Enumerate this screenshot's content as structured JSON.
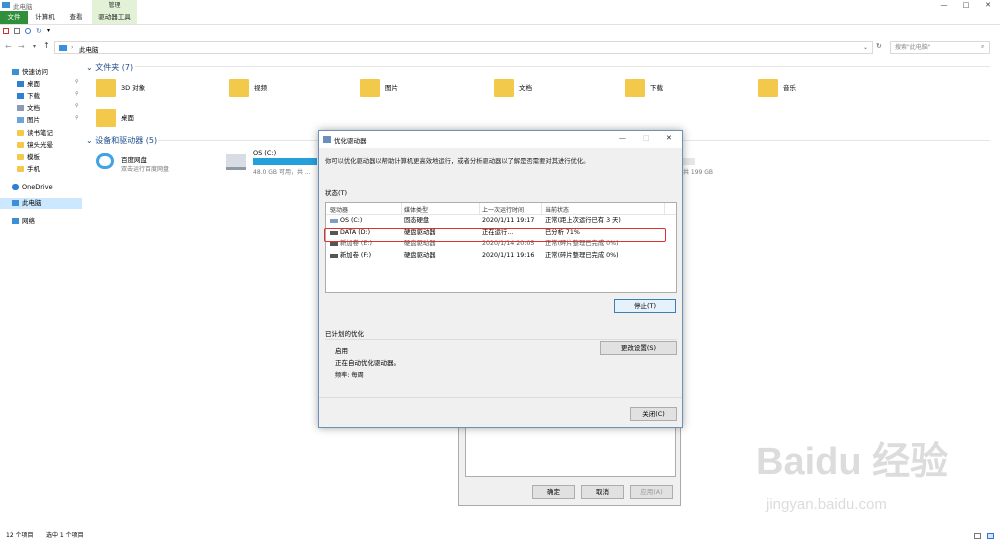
{
  "window": {
    "title": "此电脑",
    "minimize": "—",
    "maximize": "□",
    "close": "✕"
  },
  "ribbon": {
    "tabs": [
      "文件",
      "计算机",
      "查看",
      "驱动器工具"
    ],
    "context_header": "管理"
  },
  "address": {
    "path": "此电脑",
    "search_placeholder": "搜索\"此电脑\""
  },
  "nav": {
    "items": [
      {
        "label": "快速访问",
        "icon": "star-icon"
      },
      {
        "label": "桌面",
        "icon": "desktop-icon"
      },
      {
        "label": "下载",
        "icon": "download-icon"
      },
      {
        "label": "文档",
        "icon": "document-icon"
      },
      {
        "label": "图片",
        "icon": "picture-icon"
      },
      {
        "label": "读书笔记",
        "icon": "folder-icon"
      },
      {
        "label": "镜头光晕",
        "icon": "folder-icon"
      },
      {
        "label": "模板",
        "icon": "folder-icon"
      },
      {
        "label": "手机",
        "icon": "folder-icon"
      },
      {
        "label": "OneDrive",
        "icon": "cloud-icon"
      },
      {
        "label": "此电脑",
        "icon": "pc-icon"
      },
      {
        "label": "网络",
        "icon": "network-icon"
      }
    ]
  },
  "folders_section": {
    "title": "文件夹 (7)",
    "items": [
      "3D 对象",
      "视频",
      "图片",
      "文档",
      "下载",
      "音乐",
      "桌面"
    ]
  },
  "devices_section": {
    "title": "设备和驱动器 (5)",
    "items": [
      {
        "name": "百度网盘",
        "sub": "双击运行百度网盘"
      },
      {
        "name": "OS (C:)",
        "sub": "48.0 GB 可用，共 ..."
      }
    ],
    "right_partial": "共 199 GB"
  },
  "status_bar": {
    "count": "12 个项目",
    "selected": "选中 1 个项目"
  },
  "bg_dialog": {
    "ok": "确定",
    "cancel": "取消",
    "apply": "应用(A)"
  },
  "dialog": {
    "title": "优化驱动器",
    "description": "你可以优化驱动器以帮助计算机更高效地运行，或者分析驱动器以了解是否需要对其进行优化。",
    "status_label": "状态(T)",
    "columns": [
      "驱动器",
      "媒体类型",
      "上一次运行时间",
      "当前状态"
    ],
    "rows": [
      {
        "drive": "OS (C:)",
        "media": "固态硬盘",
        "last": "2020/1/11 19:17",
        "status": "正常(距上次运行已有 3 天)"
      },
      {
        "drive": "DATA (D:)",
        "media": "硬盘驱动器",
        "last": "正在运行...",
        "status": "已分析 71%"
      },
      {
        "drive": "新加卷 (E:)",
        "media": "硬盘驱动器",
        "last": "2020/1/14 20:05",
        "status": "正常(碎片整理已完成 0%)"
      },
      {
        "drive": "新加卷 (F:)",
        "media": "硬盘驱动器",
        "last": "2020/1/11 19:16",
        "status": "正常(碎片整理已完成 0%)"
      }
    ],
    "stop_button": "停止(T)",
    "scheduled_label": "已计划的优化",
    "sched_on": "启用",
    "sched_desc": "正在自动优化驱动器。",
    "sched_freq": "频率: 每周",
    "change_settings": "更改设置(S)",
    "close_button": "关闭(C)"
  },
  "watermark": {
    "brand": "Baidu 经验",
    "url": "jingyan.baidu.com"
  },
  "colors": {
    "accent": "#1979ca",
    "highlight": "#e0312f",
    "drivebar": "#26a0da"
  }
}
